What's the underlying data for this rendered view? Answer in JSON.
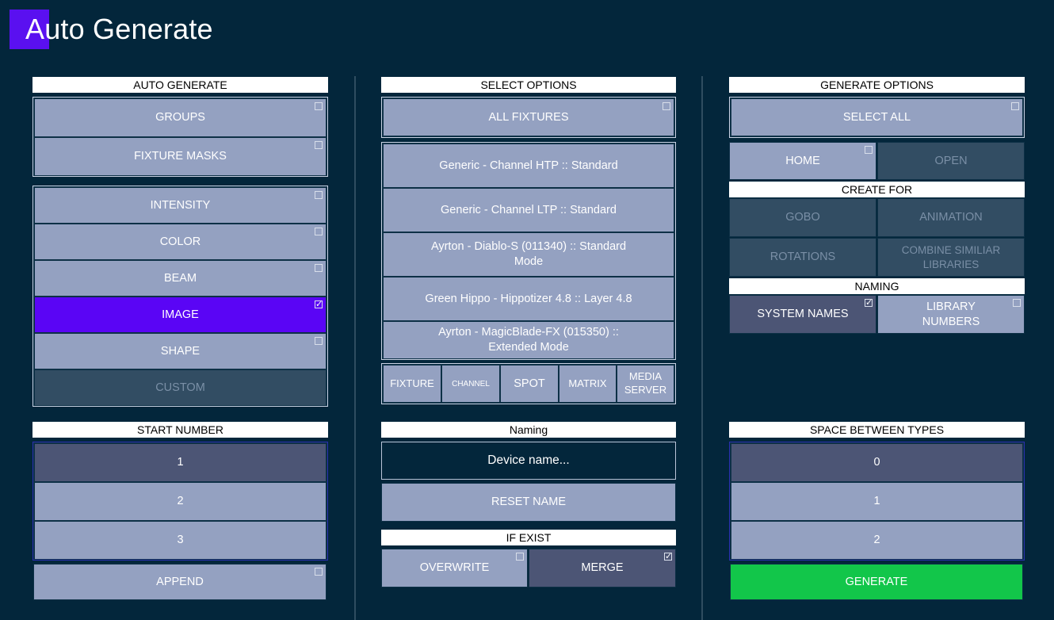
{
  "app": {
    "title": "Auto Generate",
    "accent_color": "#5a10f0"
  },
  "auto_generate": {
    "header": "AUTO GENERATE",
    "top_items": [
      {
        "label": "GROUPS",
        "checked": false
      },
      {
        "label": "FIXTURE MASKS",
        "checked": false
      }
    ],
    "library_items": [
      {
        "label": "INTENSITY",
        "checked": false,
        "state": "normal"
      },
      {
        "label": "COLOR",
        "checked": false,
        "state": "normal"
      },
      {
        "label": "BEAM",
        "checked": false,
        "state": "normal"
      },
      {
        "label": "IMAGE",
        "checked": true,
        "state": "selected"
      },
      {
        "label": "SHAPE",
        "checked": false,
        "state": "normal"
      },
      {
        "label": "CUSTOM",
        "checked": false,
        "state": "disabled"
      }
    ]
  },
  "start_number": {
    "header": "START NUMBER",
    "options": [
      "1",
      "2",
      "3"
    ],
    "selected": "1",
    "append_label": "APPEND",
    "append_checked": false
  },
  "select_options": {
    "header": "SELECT OPTIONS",
    "all_fixtures_label": "ALL FIXTURES",
    "all_fixtures_checked": false,
    "fixtures": [
      "Generic - Channel HTP :: Standard",
      "Generic - Channel LTP :: Standard",
      "Ayrton - Diablo-S (011340) :: Standard Mode",
      "Green Hippo - Hippotizer 4.8 :: Layer 4.8",
      "Ayrton - MagicBlade-FX (015350) :: Extended Mode"
    ],
    "filters": [
      "FIXTURE",
      "CHANNEL",
      "SPOT",
      "MATRIX",
      "MEDIA SERVER"
    ]
  },
  "naming": {
    "header": "Naming",
    "device_name_value": "Device name...",
    "reset_label": "RESET NAME"
  },
  "if_exist": {
    "header": "IF EXIST",
    "overwrite_label": "OVERWRITE",
    "overwrite_checked": false,
    "merge_label": "MERGE",
    "merge_checked": true
  },
  "generate_options": {
    "header": "GENERATE OPTIONS",
    "select_all_label": "SELECT ALL",
    "select_all_checked": false,
    "home_label": "HOME",
    "home_checked": false,
    "open_label": "OPEN",
    "create_for_header": "CREATE FOR",
    "create_for": [
      "GOBO",
      "ANIMATION",
      "ROTATIONS",
      "COMBINE SIMILIAR LIBRARIES"
    ],
    "naming_header": "NAMING",
    "system_names_label": "SYSTEM NAMES",
    "system_names_checked": true,
    "library_numbers_label": "LIBRARY NUMBERS",
    "library_numbers_checked": false
  },
  "space_between": {
    "header": "SPACE BETWEEN TYPES",
    "options": [
      "0",
      "1",
      "2"
    ],
    "selected": "0",
    "generate_label": "GENERATE",
    "generate_color": "#12c64a"
  }
}
